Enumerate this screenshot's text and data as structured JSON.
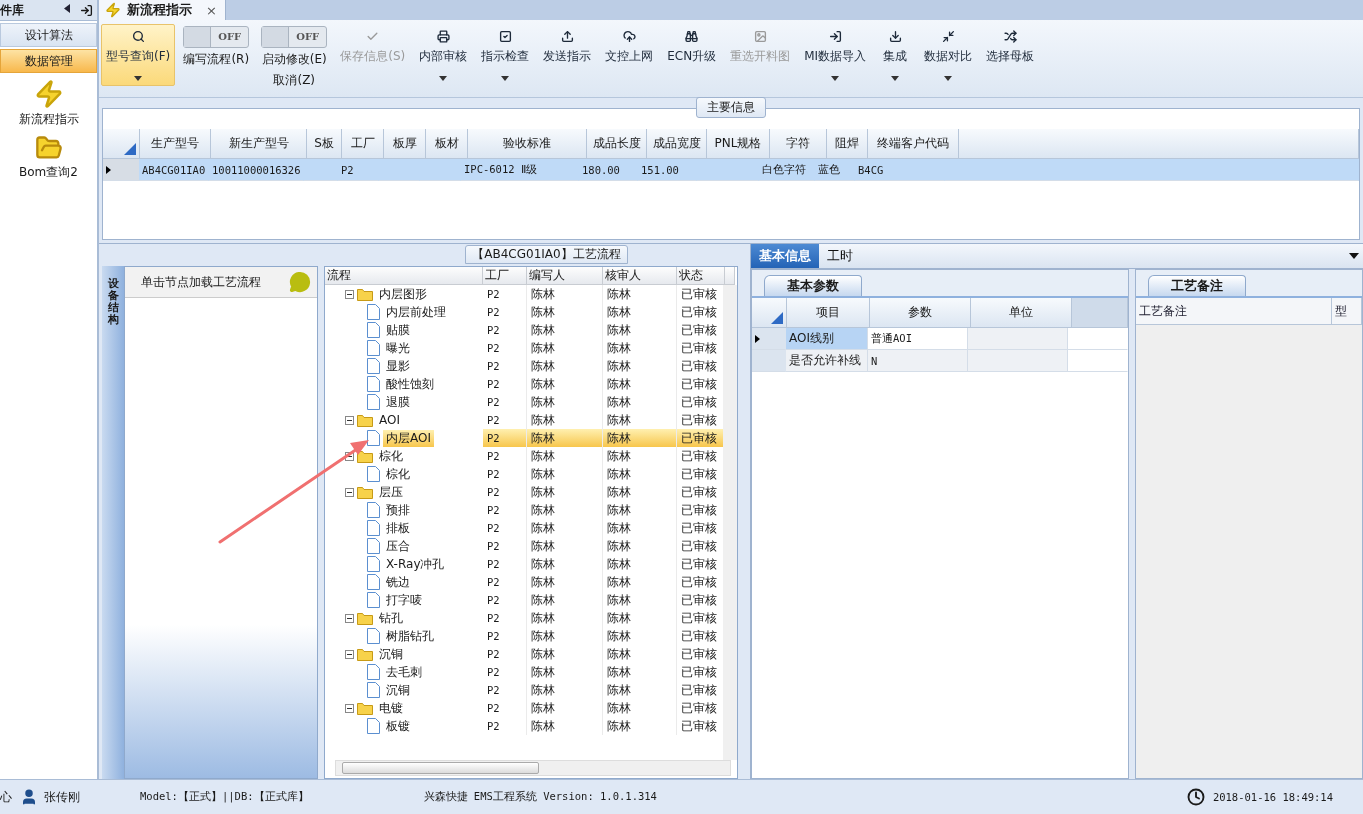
{
  "sidebar": {
    "title": "件库",
    "items": [
      {
        "label": "设计算法",
        "selected": false
      },
      {
        "label": "数据管理",
        "selected": true
      }
    ],
    "shortcuts": [
      {
        "label": "新流程指示"
      },
      {
        "label": "Bom查询2"
      }
    ]
  },
  "tabs": [
    {
      "label": "新流程指示",
      "selected": true,
      "close": "×"
    }
  ],
  "toolbar": [
    {
      "kind": "button",
      "label": "型号查询(F)",
      "selected": true,
      "disabled": false,
      "dropdown": true
    },
    {
      "kind": "toggle",
      "label": "编写流程(R)",
      "state": "OFF",
      "on": false
    },
    {
      "kind": "toggle",
      "label": "启动修改(E)",
      "label2": "取消(Z)",
      "state": "OFF",
      "on": false
    },
    {
      "kind": "button",
      "label": "保存信息(S)",
      "selected": false,
      "disabled": true,
      "dropdown": false
    },
    {
      "kind": "button",
      "label": "内部审核",
      "selected": false,
      "disabled": false,
      "dropdown": true
    },
    {
      "kind": "button",
      "label": "指示检查",
      "selected": false,
      "disabled": false,
      "dropdown": true
    },
    {
      "kind": "button",
      "label": "发送指示",
      "selected": false,
      "disabled": false,
      "dropdown": false
    },
    {
      "kind": "button",
      "label": "文控上网",
      "selected": false,
      "disabled": false,
      "dropdown": false
    },
    {
      "kind": "button",
      "label": "ECN升级",
      "selected": false,
      "disabled": false,
      "dropdown": false
    },
    {
      "kind": "button",
      "label": "重选开料图",
      "selected": false,
      "disabled": true,
      "dropdown": false
    },
    {
      "kind": "button",
      "label": "MI数据导入",
      "selected": false,
      "disabled": false,
      "dropdown": true
    },
    {
      "kind": "button",
      "label": "集成",
      "selected": false,
      "disabled": false,
      "dropdown": true
    },
    {
      "kind": "button",
      "label": "数据对比",
      "selected": false,
      "disabled": false,
      "dropdown": true
    },
    {
      "kind": "button",
      "label": "选择母板",
      "selected": false,
      "disabled": false,
      "dropdown": false
    }
  ],
  "main_info": {
    "title": "主要信息",
    "columns": [
      "生产型号",
      "新生产型号",
      "S板",
      "工厂",
      "板厚",
      "板材",
      "验收标准",
      "成品长度",
      "成品宽度",
      "PNL规格",
      "字符",
      "阻焊",
      "终端客户代码"
    ],
    "rows": [
      {
        "selected": true,
        "cells": [
          "AB4CG01IA0",
          "10011000016326",
          null,
          "P2",
          null,
          null,
          "IPC-6012 Ⅱ级",
          "180.00",
          "151.00",
          null,
          "白色字符",
          "蓝色",
          "B4CG"
        ]
      }
    ]
  },
  "process": {
    "title": "【AB4CG01IA0】工艺流程",
    "side_tab": "设备结构",
    "hint": "单击节点加载工艺流程",
    "columns": [
      "流程",
      "工厂",
      "编写人",
      "核审人",
      "状态"
    ],
    "tree": [
      {
        "name": "内层图形",
        "factory": "P2",
        "writer": "陈林",
        "reviewer": "陈林",
        "status": "已审核",
        "expanded": true,
        "selected": false,
        "children": [
          {
            "name": "内层前处理",
            "factory": "P2",
            "writer": "陈林",
            "reviewer": "陈林",
            "status": "已审核",
            "selected": false
          },
          {
            "name": "贴膜",
            "factory": "P2",
            "writer": "陈林",
            "reviewer": "陈林",
            "status": "已审核",
            "selected": false
          },
          {
            "name": "曝光",
            "factory": "P2",
            "writer": "陈林",
            "reviewer": "陈林",
            "status": "已审核",
            "selected": false
          },
          {
            "name": "显影",
            "factory": "P2",
            "writer": "陈林",
            "reviewer": "陈林",
            "status": "已审核",
            "selected": false
          },
          {
            "name": "酸性蚀刻",
            "factory": "P2",
            "writer": "陈林",
            "reviewer": "陈林",
            "status": "已审核",
            "selected": false
          },
          {
            "name": "退膜",
            "factory": "P2",
            "writer": "陈林",
            "reviewer": "陈林",
            "status": "已审核",
            "selected": false
          }
        ]
      },
      {
        "name": "AOI",
        "factory": "P2",
        "writer": "陈林",
        "reviewer": "陈林",
        "status": "已审核",
        "expanded": true,
        "selected": false,
        "children": [
          {
            "name": "内层AOI",
            "factory": "P2",
            "writer": "陈林",
            "reviewer": "陈林",
            "status": "已审核",
            "selected": true
          }
        ]
      },
      {
        "name": "棕化",
        "factory": "P2",
        "writer": "陈林",
        "reviewer": "陈林",
        "status": "已审核",
        "expanded": true,
        "selected": false,
        "children": [
          {
            "name": "棕化",
            "factory": "P2",
            "writer": "陈林",
            "reviewer": "陈林",
            "status": "已审核",
            "selected": false
          }
        ]
      },
      {
        "name": "层压",
        "factory": "P2",
        "writer": "陈林",
        "reviewer": "陈林",
        "status": "已审核",
        "expanded": true,
        "selected": false,
        "children": [
          {
            "name": "预排",
            "factory": "P2",
            "writer": "陈林",
            "reviewer": "陈林",
            "status": "已审核",
            "selected": false
          },
          {
            "name": "排板",
            "factory": "P2",
            "writer": "陈林",
            "reviewer": "陈林",
            "status": "已审核",
            "selected": false
          },
          {
            "name": "压合",
            "factory": "P2",
            "writer": "陈林",
            "reviewer": "陈林",
            "status": "已审核",
            "selected": false
          },
          {
            "name": "X-Ray冲孔",
            "factory": "P2",
            "writer": "陈林",
            "reviewer": "陈林",
            "status": "已审核",
            "selected": false
          },
          {
            "name": "铣边",
            "factory": "P2",
            "writer": "陈林",
            "reviewer": "陈林",
            "status": "已审核",
            "selected": false
          },
          {
            "name": "打字唛",
            "factory": "P2",
            "writer": "陈林",
            "reviewer": "陈林",
            "status": "已审核",
            "selected": false
          }
        ]
      },
      {
        "name": "钻孔",
        "factory": "P2",
        "writer": "陈林",
        "reviewer": "陈林",
        "status": "已审核",
        "expanded": true,
        "selected": false,
        "children": [
          {
            "name": "树脂钻孔",
            "factory": "P2",
            "writer": "陈林",
            "reviewer": "陈林",
            "status": "已审核",
            "selected": false
          }
        ]
      },
      {
        "name": "沉铜",
        "factory": "P2",
        "writer": "陈林",
        "reviewer": "陈林",
        "status": "已审核",
        "expanded": true,
        "selected": false,
        "children": [
          {
            "name": "去毛刺",
            "factory": "P2",
            "writer": "陈林",
            "reviewer": "陈林",
            "status": "已审核",
            "selected": false
          },
          {
            "name": "沉铜",
            "factory": "P2",
            "writer": "陈林",
            "reviewer": "陈林",
            "status": "已审核",
            "selected": false
          }
        ]
      },
      {
        "name": "电镀",
        "factory": "P2",
        "writer": "陈林",
        "reviewer": "陈林",
        "status": "已审核",
        "expanded": true,
        "selected": false,
        "children": [
          {
            "name": "板镀",
            "factory": "P2",
            "writer": "陈林",
            "reviewer": "陈林",
            "status": "已审核",
            "selected": false
          }
        ]
      }
    ]
  },
  "detail": {
    "tabs": [
      {
        "label": "基本信息",
        "selected": true
      },
      {
        "label": "工时",
        "selected": false
      }
    ],
    "params": {
      "title": "基本参数",
      "columns": [
        "项目",
        "参数",
        "单位"
      ],
      "rows": [
        {
          "selected": true,
          "cells": [
            "AOI线别",
            "普通AOI"
          ]
        },
        {
          "selected": false,
          "cells": [
            "是否允许补线",
            "N"
          ]
        }
      ]
    },
    "notes": {
      "title": "工艺备注",
      "columns": [
        "工艺备注",
        "型"
      ]
    }
  },
  "status_bar": {
    "left": "心",
    "user": "张传刚",
    "model": "Model:【正式】||DB:【正式库】",
    "product": "兴森快捷 EMS工程系统 Version: 1.0.1.314",
    "time": "2018-01-16 18:49:14"
  }
}
